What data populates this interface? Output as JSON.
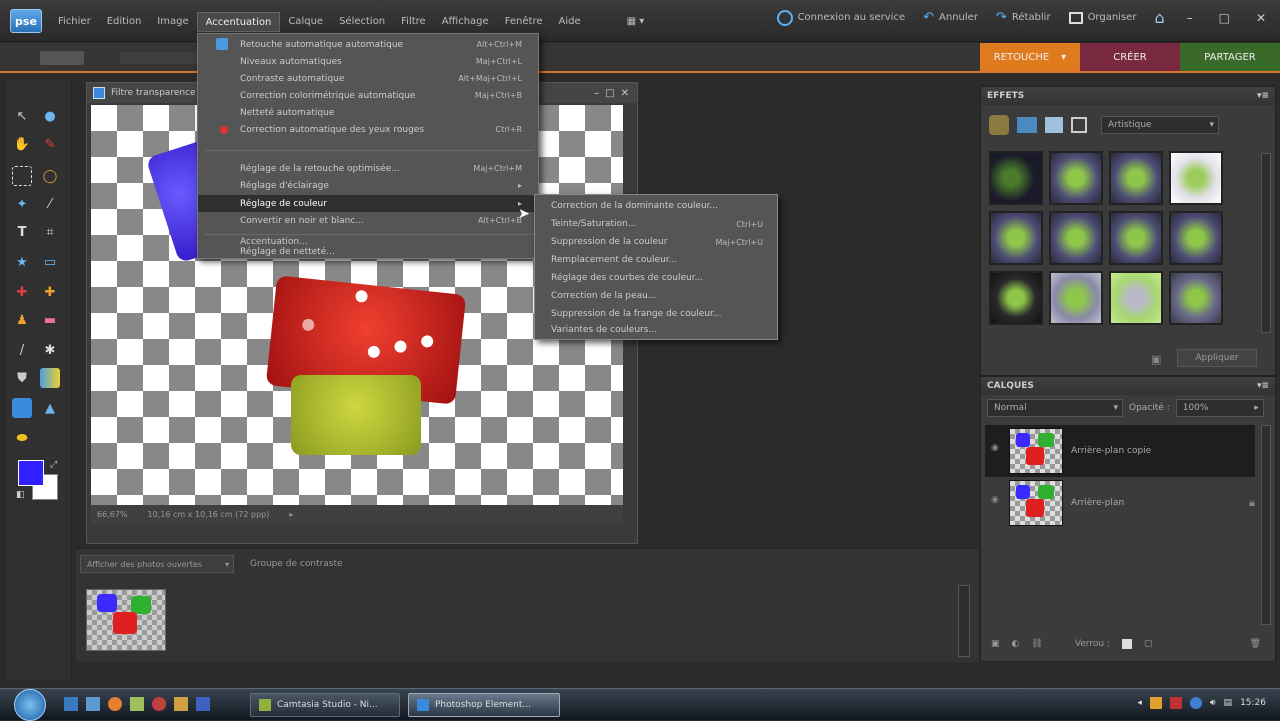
{
  "app": {
    "logo": "pse"
  },
  "menus": [
    {
      "label": "Fichier"
    },
    {
      "label": "Edition"
    },
    {
      "label": "Image"
    },
    {
      "label": "Accentuation",
      "active": true
    },
    {
      "label": "Calque"
    },
    {
      "label": "Sélection"
    },
    {
      "label": "Filtre"
    },
    {
      "label": "Affichage"
    },
    {
      "label": "Fenêtre"
    },
    {
      "label": "Aide"
    }
  ],
  "topright": {
    "connexion": "Connexion au service",
    "annuler": "Annuler",
    "retablir": "Rétablir",
    "organiser": "Organiser"
  },
  "modes": {
    "retouche": "RETOUCHE",
    "creer": "CRÉER",
    "partager": "PARTAGER"
  },
  "document": {
    "title": "Filtre transparence",
    "zoom": "66,67%",
    "info": "10,16 cm x 10,16 cm (72 ppp)"
  },
  "accent_menu": {
    "items": [
      {
        "label": "Retouche automatique automatique",
        "shortcut": "Alt+Ctrl+M"
      },
      {
        "label": "Niveaux automatiques",
        "shortcut": "Maj+Ctrl+L"
      },
      {
        "label": "Contraste automatique",
        "shortcut": "Alt+Maj+Ctrl+L"
      },
      {
        "label": "Correction colorimétrique automatique",
        "shortcut": "Maj+Ctrl+B"
      },
      {
        "label": "Netteté automatique",
        "shortcut": ""
      },
      {
        "label": "Correction automatique des yeux rouges",
        "shortcut": "Ctrl+R"
      },
      {
        "label": "Réglage de la retouche optimisée...",
        "shortcut": "Maj+Ctrl+M"
      },
      {
        "label": "Réglage d'éclairage",
        "shortcut": ""
      },
      {
        "label": "Réglage de couleur",
        "shortcut": ""
      },
      {
        "label": "Convertir en noir et blanc...",
        "shortcut": "Alt+Ctrl+B"
      },
      {
        "label": "Accentuation...",
        "shortcut": ""
      },
      {
        "label": "Réglage de netteté...",
        "shortcut": ""
      }
    ]
  },
  "color_submenu": {
    "items": [
      {
        "label": "Correction de la dominante couleur...",
        "shortcut": ""
      },
      {
        "label": "Teinte/Saturation...",
        "shortcut": "Ctrl+U"
      },
      {
        "label": "Suppression de la couleur",
        "shortcut": "Maj+Ctrl+U"
      },
      {
        "label": "Remplacement de couleur...",
        "shortcut": ""
      },
      {
        "label": "Réglage des courbes de couleur...",
        "shortcut": ""
      },
      {
        "label": "Correction de la peau...",
        "shortcut": ""
      },
      {
        "label": "Suppression de la frange de couleur...",
        "shortcut": ""
      },
      {
        "label": "Variantes de couleurs...",
        "shortcut": ""
      }
    ]
  },
  "effets": {
    "title": "EFFETS",
    "filter": "Artistique",
    "footer": "Appliquer"
  },
  "calques": {
    "title": "CALQUES",
    "blend": "Normal",
    "opacity_label": "Opacité :",
    "opacity_value": "100%",
    "layers": [
      {
        "name": "Arrière-plan copie",
        "selected": true
      },
      {
        "name": "Arrière-plan",
        "locked": true
      }
    ],
    "footer": "Verrou :"
  },
  "bin": {
    "dropdown": "Afficher des photos ouvertes",
    "tab": "Groupe de contraste"
  },
  "taskbar": {
    "tasks": [
      {
        "label": "Camtasia Studio - Ni..."
      },
      {
        "label": "Photoshop Element...",
        "active": true
      }
    ],
    "time": "15:26"
  },
  "colors": {
    "accent": "#d9742a",
    "retouche_tab": "#e07a1f",
    "creer_tab": "#7a2a40",
    "partager_tab": "#3a6a2a",
    "foreground": "#3020ff",
    "background": "#ffffff"
  }
}
